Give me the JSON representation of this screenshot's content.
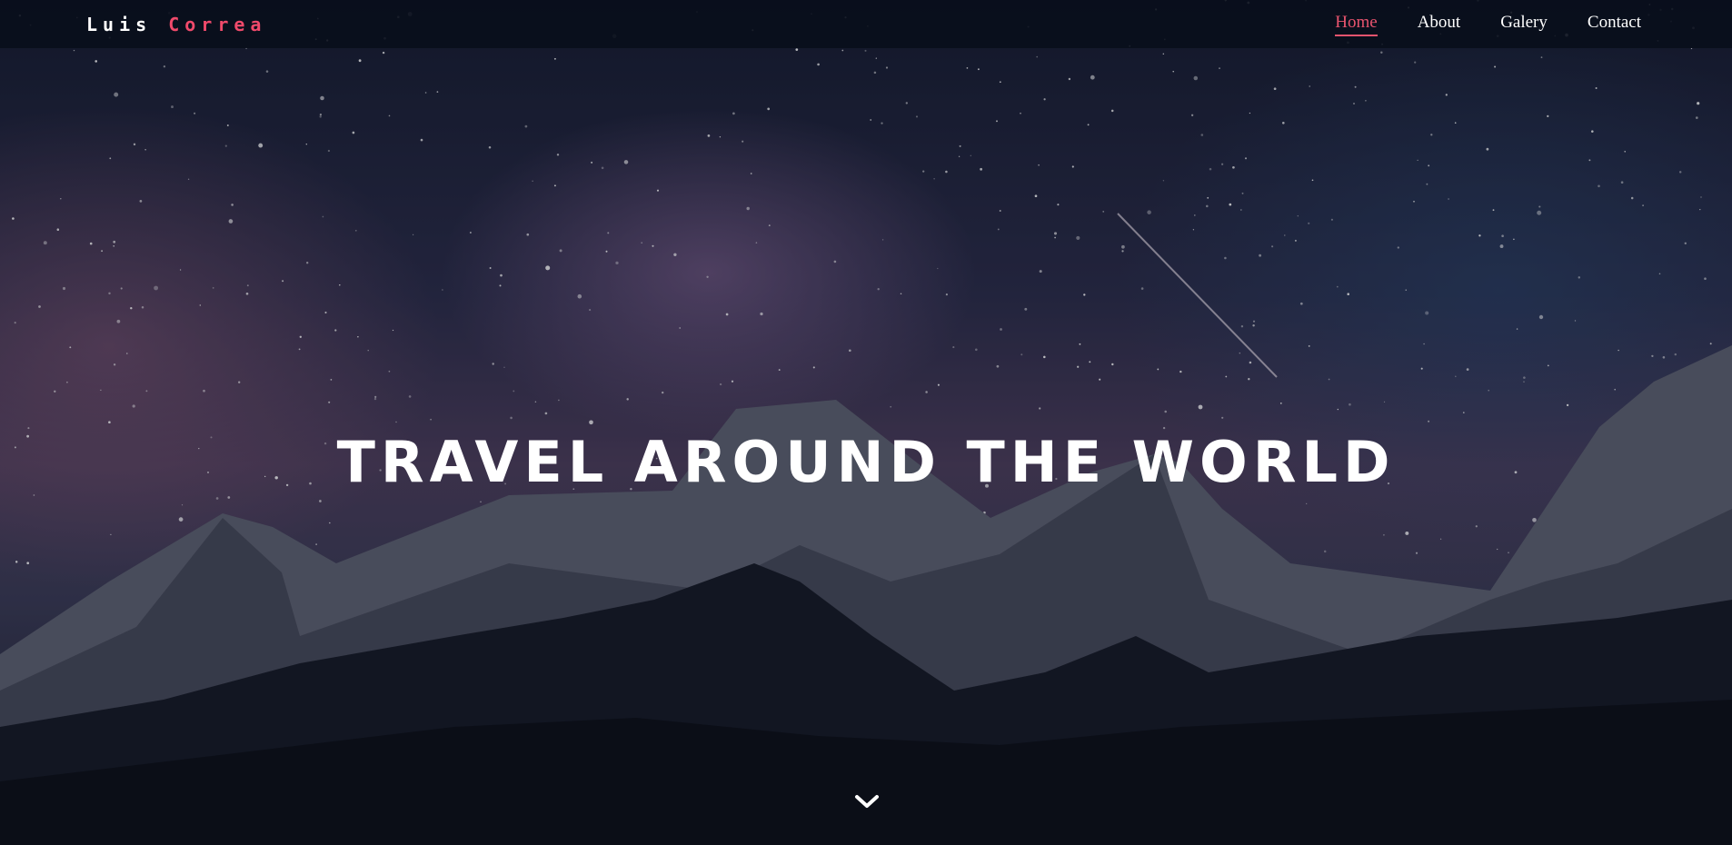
{
  "navbar": {
    "logo_first": "Luis",
    "logo_second": "Correa",
    "links": [
      {
        "label": "Home",
        "active": true
      },
      {
        "label": "About",
        "active": false
      },
      {
        "label": "Galery",
        "active": false
      },
      {
        "label": "Contact",
        "active": false
      }
    ]
  },
  "hero": {
    "headline": "TRAVEL AROUND THE WORLD",
    "scroll_icon": "chevron-down-icon"
  },
  "colors": {
    "accent": "#e8546e",
    "navbar_bg": "#080e1a",
    "text": "#ffffff"
  }
}
